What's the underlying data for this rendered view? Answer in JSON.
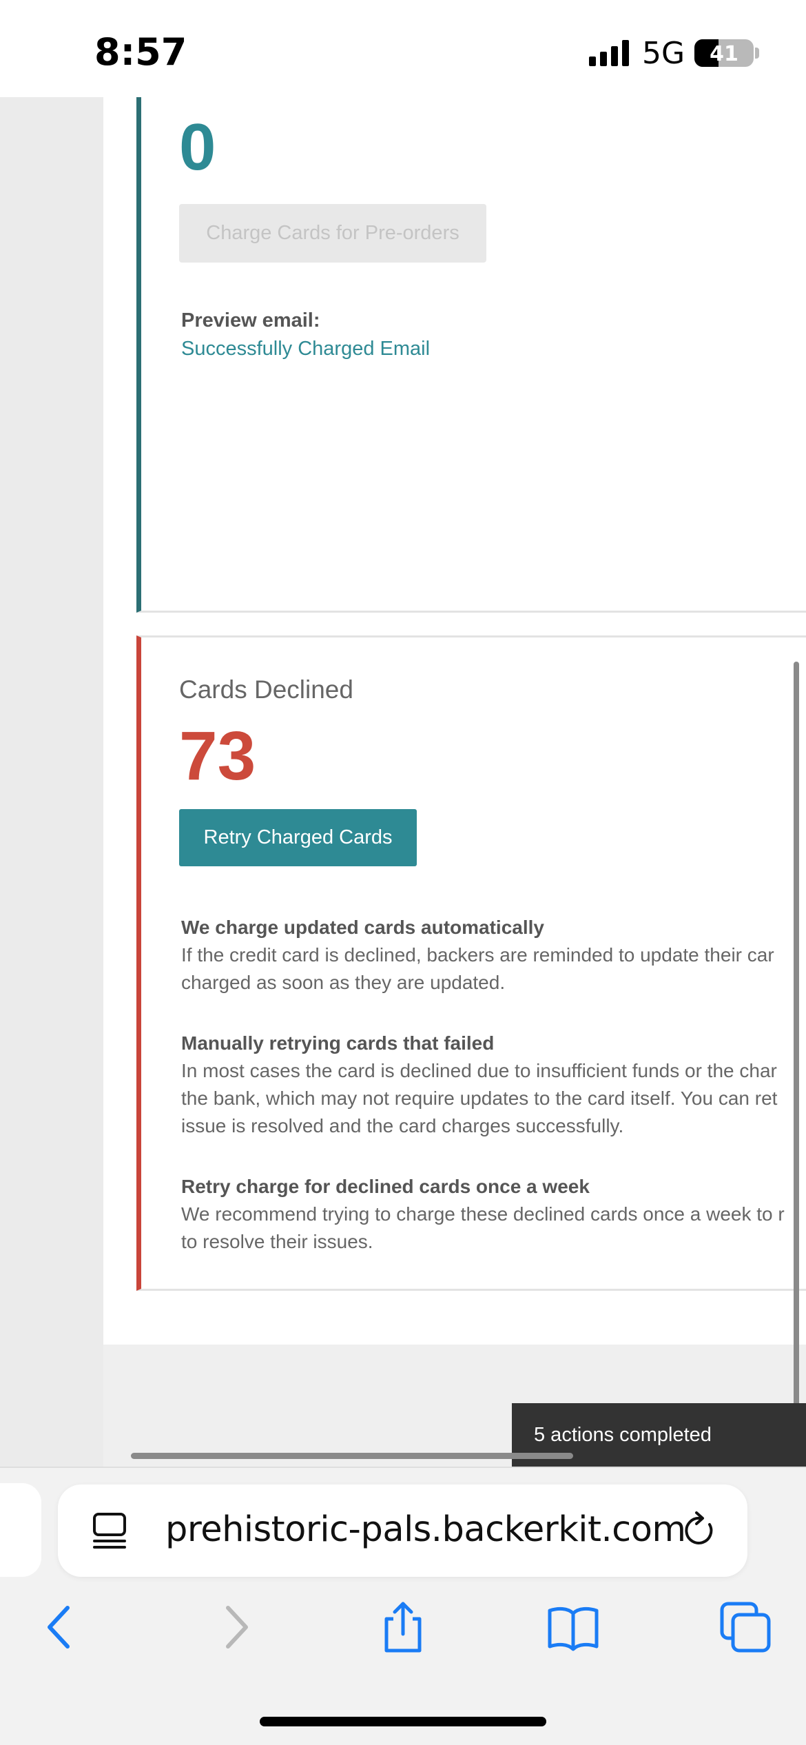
{
  "status_bar": {
    "time": "8:57",
    "network": "5G",
    "battery": "41",
    "battery_level_percent": 41
  },
  "card_charged": {
    "count": "0",
    "charge_button": "Charge Cards for Pre-orders",
    "preview_label": "Preview email:",
    "preview_link": "Successfully Charged Email"
  },
  "card_declined": {
    "title": "Cards Declined",
    "count": "73",
    "retry_button": "Retry Charged Cards",
    "info": [
      {
        "heading": "We charge updated cards automatically",
        "lines": [
          "If the credit card is declined, backers are reminded to update their car",
          "charged as soon as they are updated."
        ]
      },
      {
        "heading": "Manually retrying cards that failed",
        "lines": [
          "In most cases the card is declined due to insufficient funds or the char",
          "the bank, which may not require updates to the card itself. You can ret",
          "issue is resolved and the card charges successfully."
        ]
      },
      {
        "heading": "Retry charge for declined cards once a week",
        "lines": [
          "We recommend trying to charge these declined cards once a week to r",
          "to resolve their issues."
        ]
      }
    ]
  },
  "toast": {
    "text": "5 actions completed"
  },
  "browser": {
    "url": "prehistoric-pals.backerkit.com"
  },
  "icons": [
    "tab-overview-icon",
    "reload-icon",
    "back-icon",
    "forward-icon",
    "share-icon",
    "bookmarks-icon",
    "tabs-icon"
  ],
  "colors": {
    "teal": "#2e8a94",
    "red": "#cc4a3b",
    "ios_blue": "#1a7cf5"
  }
}
